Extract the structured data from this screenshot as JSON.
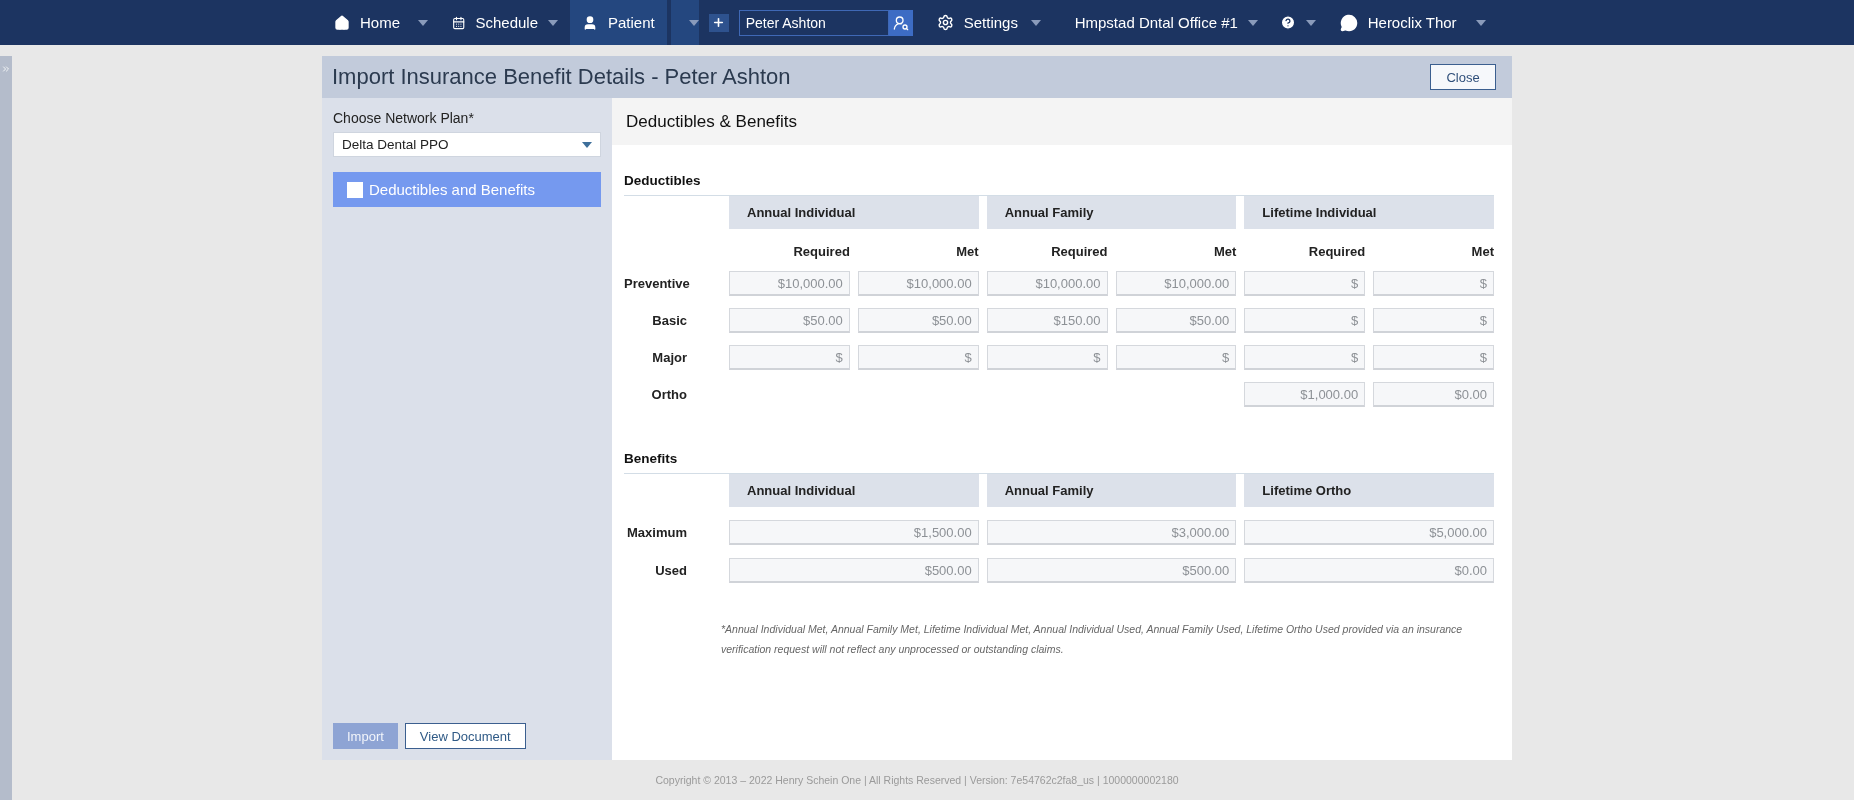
{
  "nav": {
    "left_menus": [
      {
        "kind": "home",
        "label": "Home",
        "selected": false
      },
      {
        "kind": "schedule",
        "label": "Schedule",
        "selected": false
      },
      {
        "kind": "patient",
        "label": "Patient",
        "selected": true
      }
    ],
    "search": {
      "value": "Peter Ashton"
    },
    "right_menus": [
      {
        "kind": "settings",
        "label": "Settings"
      },
      {
        "kind": "location",
        "label": "Hmpstad Dntal Office #1"
      },
      {
        "kind": "help"
      },
      {
        "kind": "user",
        "label": "Heroclix Thor"
      }
    ]
  },
  "dialog": {
    "title": "Import Insurance Benefit Details - Peter Ashton",
    "close_button": "Close",
    "sidebar": {
      "plan_label": "Choose Network Plan*",
      "plan_value": "Delta Dental PPO",
      "sections": [
        {
          "label": "Deductibles and Benefits",
          "selected": true,
          "checked": false
        }
      ],
      "buttons": [
        {
          "label": "Import",
          "kind": "primary",
          "disabled": true
        },
        {
          "label": "View Document",
          "kind": "secondary",
          "disabled": false
        }
      ]
    },
    "panel_title": "Deductibles & Benefits",
    "deductibles": {
      "title": "Deductibles",
      "groups": [
        "Annual Individual",
        "Annual Family",
        "Lifetime Individual"
      ],
      "subcolumns": [
        "Required",
        "Met",
        "Required",
        "Met",
        "Required",
        "Met"
      ],
      "rows": [
        {
          "label": "Preventive",
          "cells": [
            "$10,000.00",
            "$10,000.00",
            "$10,000.00",
            "$10,000.00",
            "$",
            "$"
          ]
        },
        {
          "label": "Basic",
          "cells": [
            "$50.00",
            "$50.00",
            "$150.00",
            "$50.00",
            "$",
            "$"
          ]
        },
        {
          "label": "Major",
          "cells": [
            "$",
            "$",
            "$",
            "$",
            "$",
            "$"
          ]
        },
        {
          "label": "Ortho",
          "cells": [
            null,
            null,
            null,
            null,
            "$1,000.00",
            "$0.00"
          ]
        }
      ]
    },
    "benefits": {
      "title": "Benefits",
      "groups": [
        "Annual Individual",
        "Annual Family",
        "Lifetime Ortho"
      ],
      "rows": [
        {
          "label": "Maximum",
          "cells": [
            "$1,500.00",
            "$3,000.00",
            "$5,000.00"
          ]
        },
        {
          "label": "Used",
          "cells": [
            "$500.00",
            "$500.00",
            "$0.00"
          ]
        }
      ]
    },
    "footnote": "*Annual Individual Met, Annual Family Met, Lifetime Individual Met, Annual Individual Used, Annual Family Used, Lifetime Ortho Used provided via an insurance verification request will not reflect any unprocessed or outstanding claims."
  },
  "footer": "Copyright © 2013 – 2022 Henry Schein One | All Rights Reserved | Version: 7e54762c2fa8_us | 1000000002180"
}
